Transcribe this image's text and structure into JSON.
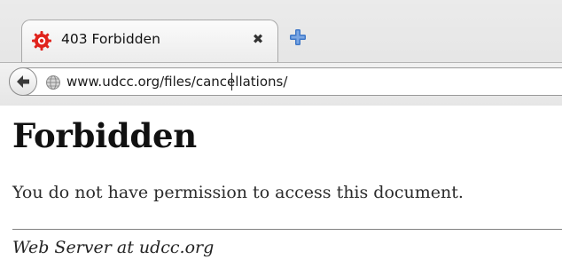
{
  "browser": {
    "tab": {
      "title": "403 Forbidden",
      "favicon": "error-gear-icon",
      "close_glyph": "✖"
    },
    "new_tab_icon": "plus-icon",
    "nav": {
      "back_icon": "back-arrow-icon",
      "site_icon": "globe-icon",
      "url": "www.udcc.org/files/cancellations/"
    },
    "colors": {
      "favicon_red": "#e0231c",
      "new_tab_blue": "#3f78c8"
    }
  },
  "page": {
    "heading": "Forbidden",
    "message": "You do not have permission to access this document.",
    "address": "Web Server at udcc.org"
  }
}
